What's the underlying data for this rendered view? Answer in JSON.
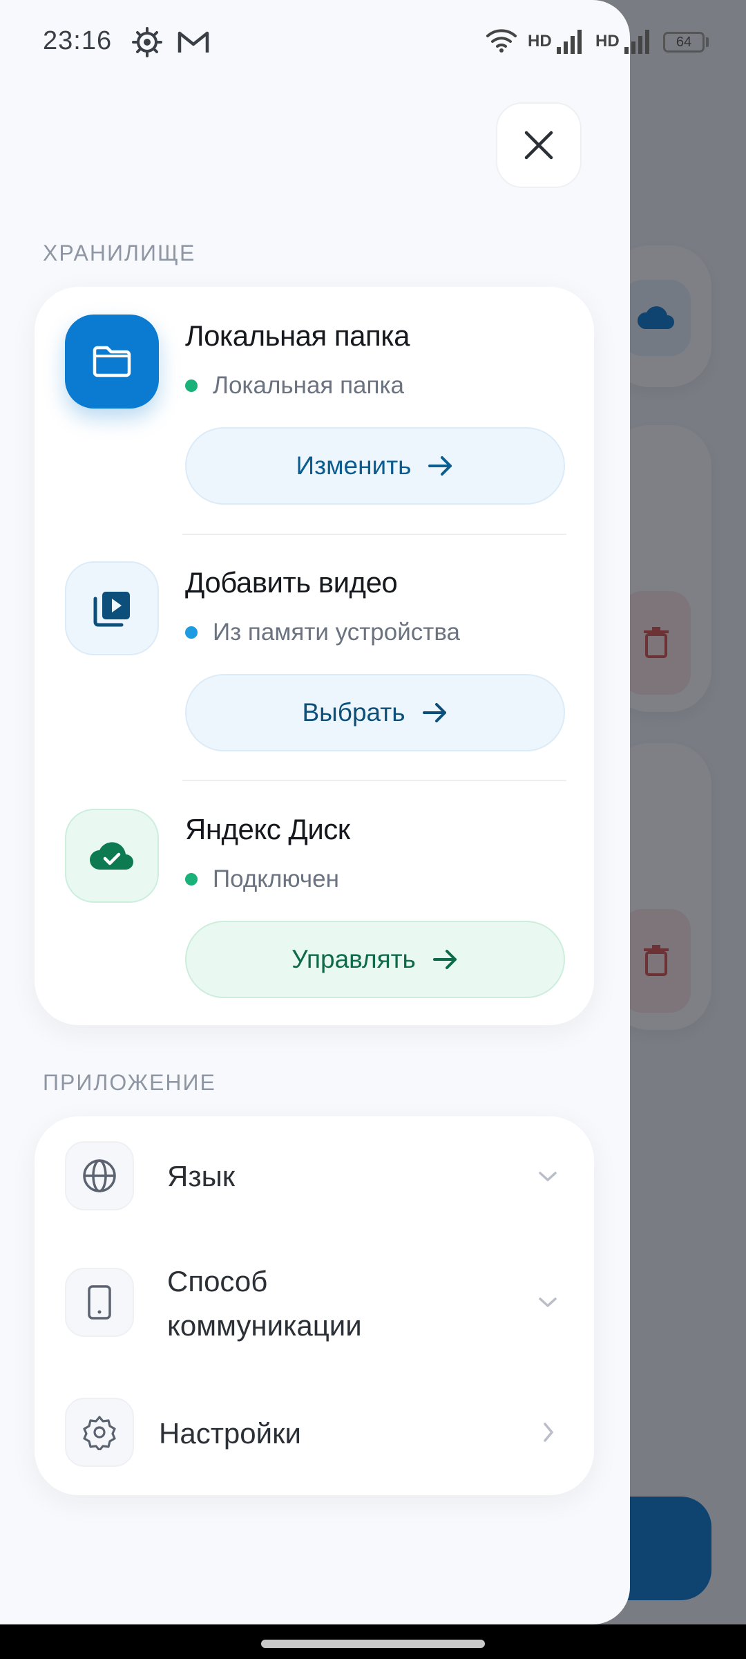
{
  "status_bar": {
    "time": "23:16",
    "hd1": "HD",
    "hd2": "HD",
    "battery": "64",
    "icons": [
      "gear-icon",
      "gmail-icon",
      "wifi-icon",
      "signal-icon",
      "battery-icon"
    ]
  },
  "storage_section": {
    "label": "ХРАНИЛИЩЕ",
    "items": [
      {
        "title": "Локальная папка",
        "subtitle": "Локальная папка",
        "status_color": "#1bb27a",
        "button_label": "Изменить",
        "icon": "folder-icon",
        "accent": "#0a7bd1"
      },
      {
        "title": "Добавить видео",
        "subtitle": "Из памяти устройства",
        "status_color": "#1d9be0",
        "button_label": "Выбрать",
        "icon": "video-library-icon",
        "accent": "#0b4f7a"
      },
      {
        "title": "Яндекс Диск",
        "subtitle": "Подключен",
        "status_color": "#1bb27a",
        "button_label": "Управлять",
        "icon": "cloud-check-icon",
        "accent": "#0d7a52"
      }
    ]
  },
  "app_section": {
    "label": "ПРИЛОЖЕНИЕ",
    "items": [
      {
        "label": "Язык",
        "icon": "globe-icon"
      },
      {
        "label_line1": "Способ",
        "label_line2": "коммуникации",
        "icon": "phone-icon"
      },
      {
        "label": "Настройки",
        "icon": "settings-icon"
      }
    ]
  }
}
